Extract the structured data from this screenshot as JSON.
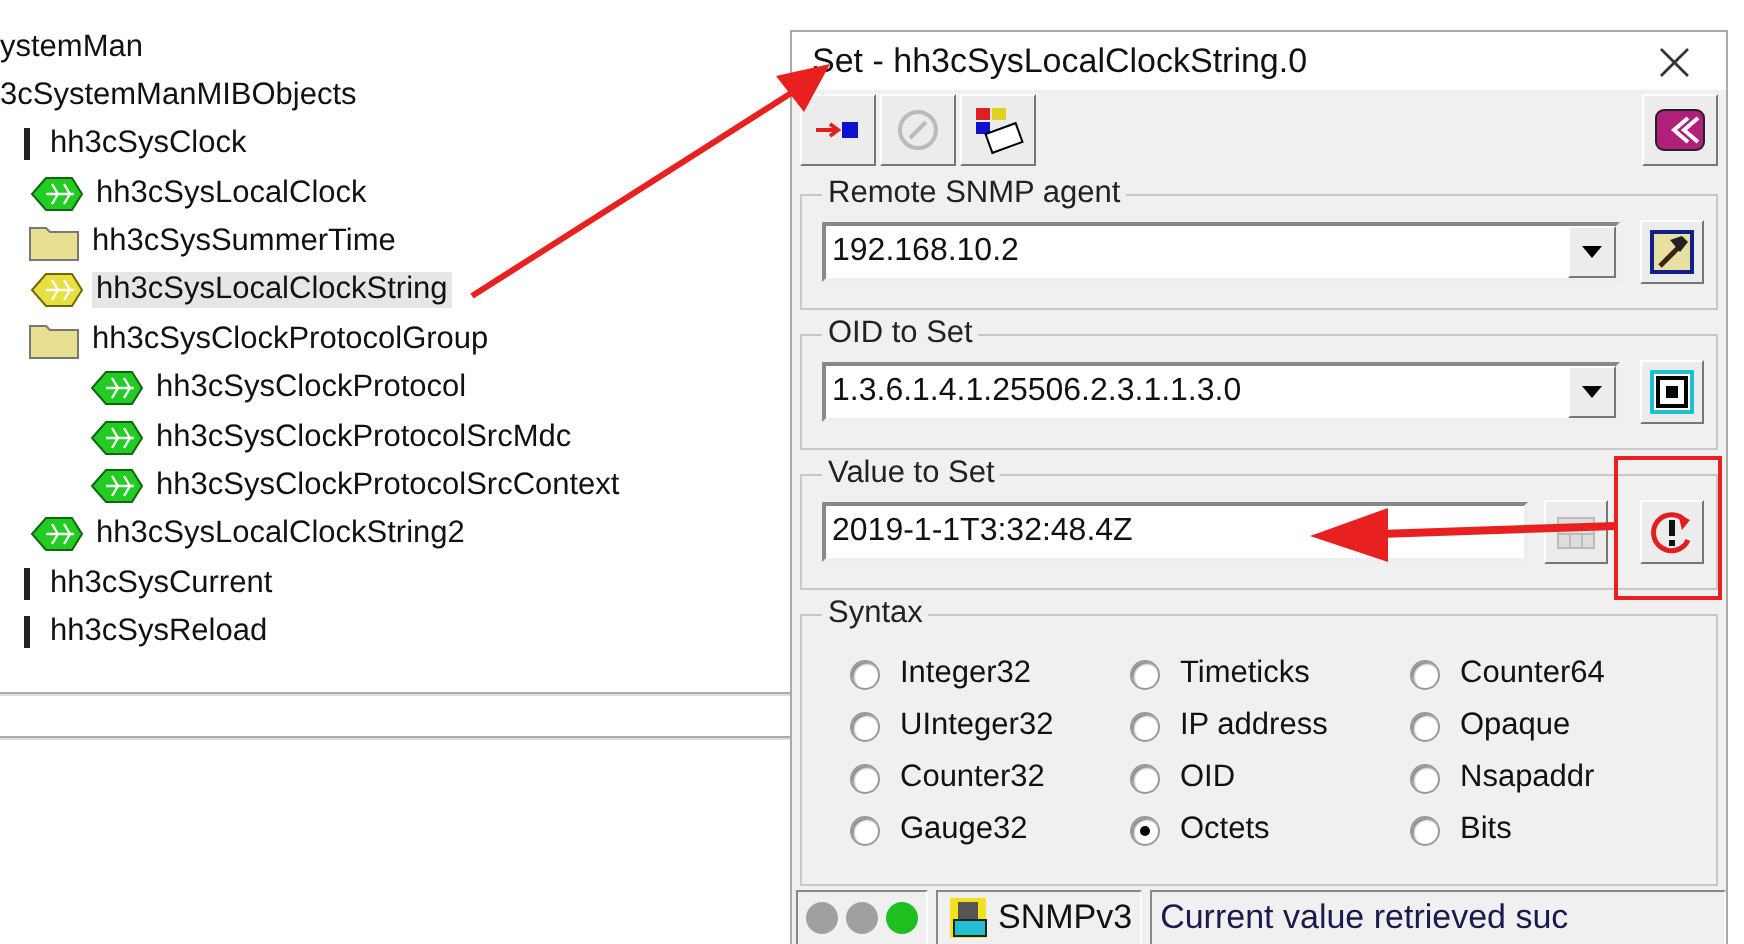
{
  "tree": {
    "cut_items": [
      "ystemMan",
      "3cSystemManMIBObjects"
    ],
    "nodes": [
      {
        "label": "hh3cSysClock",
        "kind": "branch",
        "selected": false,
        "children": [
          {
            "label": "hh3cSysLocalClock",
            "kind": "leaf",
            "selected": false
          },
          {
            "label": "hh3cSysSummerTime",
            "kind": "folder",
            "selected": false
          },
          {
            "label": "hh3cSysLocalClockString",
            "kind": "leaf",
            "selected": true
          },
          {
            "label": "hh3cSysClockProtocolGroup",
            "kind": "folder",
            "selected": false,
            "children": [
              {
                "label": "hh3cSysClockProtocol",
                "kind": "leaf",
                "selected": false
              },
              {
                "label": "hh3cSysClockProtocolSrcMdc",
                "kind": "leaf",
                "selected": false
              },
              {
                "label": "hh3cSysClockProtocolSrcContext",
                "kind": "leaf",
                "selected": false
              }
            ]
          },
          {
            "label": "hh3cSysLocalClockString2",
            "kind": "leaf",
            "selected": false
          }
        ]
      },
      {
        "label": "hh3cSysCurrent",
        "kind": "branch",
        "selected": false
      },
      {
        "label": "hh3cSysReload",
        "kind": "branch",
        "selected": false
      }
    ]
  },
  "dialog": {
    "title": "Set - hh3cSysLocalClockString.0",
    "close": "×",
    "groups": [
      {
        "label": "Remote SNMP agent",
        "value": "192.168.10.2",
        "kind": "dropdown"
      },
      {
        "label": "OID to Set",
        "value": "1.3.6.1.4.1.25506.2.3.1.1.3.0",
        "kind": "dropdown"
      },
      {
        "label": "Value to Set",
        "value": "2019-1-1T3:32:48.4Z",
        "kind": "text"
      }
    ],
    "syntax": {
      "label": "Syntax",
      "options": [
        {
          "label": "Integer32",
          "selected": false
        },
        {
          "label": "Timeticks",
          "selected": false
        },
        {
          "label": "Counter64",
          "selected": false
        },
        {
          "label": "UInteger32",
          "selected": false
        },
        {
          "label": "IP address",
          "selected": false
        },
        {
          "label": "Opaque",
          "selected": false
        },
        {
          "label": "Counter32",
          "selected": false
        },
        {
          "label": "OID",
          "selected": false
        },
        {
          "label": "Nsapaddr",
          "selected": false
        },
        {
          "label": "Gauge32",
          "selected": false
        },
        {
          "label": "Octets",
          "selected": true
        },
        {
          "label": "Bits",
          "selected": false
        }
      ]
    },
    "status": {
      "lights": [
        {
          "color": "#a0a0a0"
        },
        {
          "color": "#a0a0a0"
        },
        {
          "color": "#1fbf1f"
        }
      ],
      "version": "SNMPv3",
      "message": "Current value retrieved suc"
    }
  }
}
